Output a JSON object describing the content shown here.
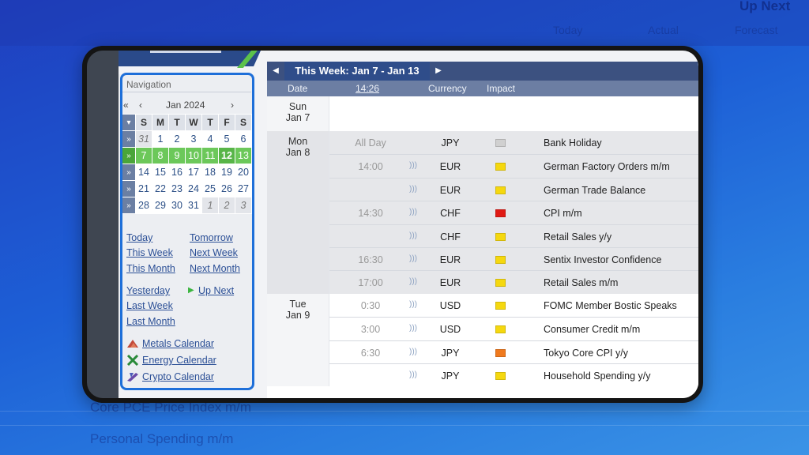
{
  "background": {
    "top_right_text": "Up Next",
    "col_headers": [
      "Today",
      "Actual",
      "Forecast"
    ],
    "row_texts": [
      "Core PCE Price Index m/m",
      "Personal Spending m/m"
    ]
  },
  "navigation": {
    "title": "Navigation",
    "prev_year": "«",
    "prev_month": "‹",
    "month_label": "Jan 2024",
    "next_month": "›",
    "weekdays": [
      "S",
      "M",
      "T",
      "W",
      "T",
      "F",
      "S"
    ],
    "weeks": [
      [
        "31",
        "1",
        "2",
        "3",
        "4",
        "5",
        "6"
      ],
      [
        "7",
        "8",
        "9",
        "10",
        "11",
        "12",
        "13"
      ],
      [
        "14",
        "15",
        "16",
        "17",
        "18",
        "19",
        "20"
      ],
      [
        "21",
        "22",
        "23",
        "24",
        "25",
        "26",
        "27"
      ],
      [
        "28",
        "29",
        "30",
        "31",
        "1",
        "2",
        "3"
      ]
    ],
    "week_marker": "»",
    "links": {
      "today": "Today",
      "tomorrow": "Tomorrow",
      "this_week": "This Week",
      "next_week": "Next Week",
      "this_month": "This Month",
      "next_month": "Next Month",
      "yesterday": "Yesterday",
      "up_next": "Up Next",
      "last_week": "Last Week",
      "last_month": "Last Month",
      "metals": "Metals Calendar",
      "energy": "Energy Calendar",
      "crypto": "Crypto Calendar"
    }
  },
  "calendar": {
    "week_label": "This Week: Jan 7 - Jan 13",
    "headers": {
      "date": "Date",
      "time": "14:26",
      "currency": "Currency",
      "impact": "Impact"
    },
    "days": [
      {
        "day": "Sun",
        "date": "Jan 7",
        "events": []
      },
      {
        "day": "Mon",
        "date": "Jan 8",
        "events": [
          {
            "time": "All Day",
            "currency": "JPY",
            "impact": "gray",
            "event": "Bank Holiday"
          },
          {
            "time": "14:00",
            "currency": "EUR",
            "impact": "yellow",
            "event": "German Factory Orders m/m"
          },
          {
            "time": "",
            "currency": "EUR",
            "impact": "yellow",
            "event": "German Trade Balance"
          },
          {
            "time": "14:30",
            "currency": "CHF",
            "impact": "red",
            "event": "CPI m/m"
          },
          {
            "time": "",
            "currency": "CHF",
            "impact": "yellow",
            "event": "Retail Sales y/y"
          },
          {
            "time": "16:30",
            "currency": "EUR",
            "impact": "yellow",
            "event": "Sentix Investor Confidence"
          },
          {
            "time": "17:00",
            "currency": "EUR",
            "impact": "yellow",
            "event": "Retail Sales m/m"
          }
        ]
      },
      {
        "day": "Tue",
        "date": "Jan 9",
        "events": [
          {
            "time": "0:30",
            "currency": "USD",
            "impact": "yellow",
            "event": "FOMC Member Bostic Speaks"
          },
          {
            "time": "3:00",
            "currency": "USD",
            "impact": "yellow",
            "event": "Consumer Credit m/m"
          },
          {
            "time": "6:30",
            "currency": "JPY",
            "impact": "orange",
            "event": "Tokyo Core CPI y/y"
          },
          {
            "time": "",
            "currency": "JPY",
            "impact": "yellow",
            "event": "Household Spending y/y"
          }
        ]
      }
    ],
    "impact_colors": {
      "gray": "#d0d0d0",
      "yellow": "#f5d80f",
      "orange": "#f07a1e",
      "red": "#e01a14"
    }
  }
}
